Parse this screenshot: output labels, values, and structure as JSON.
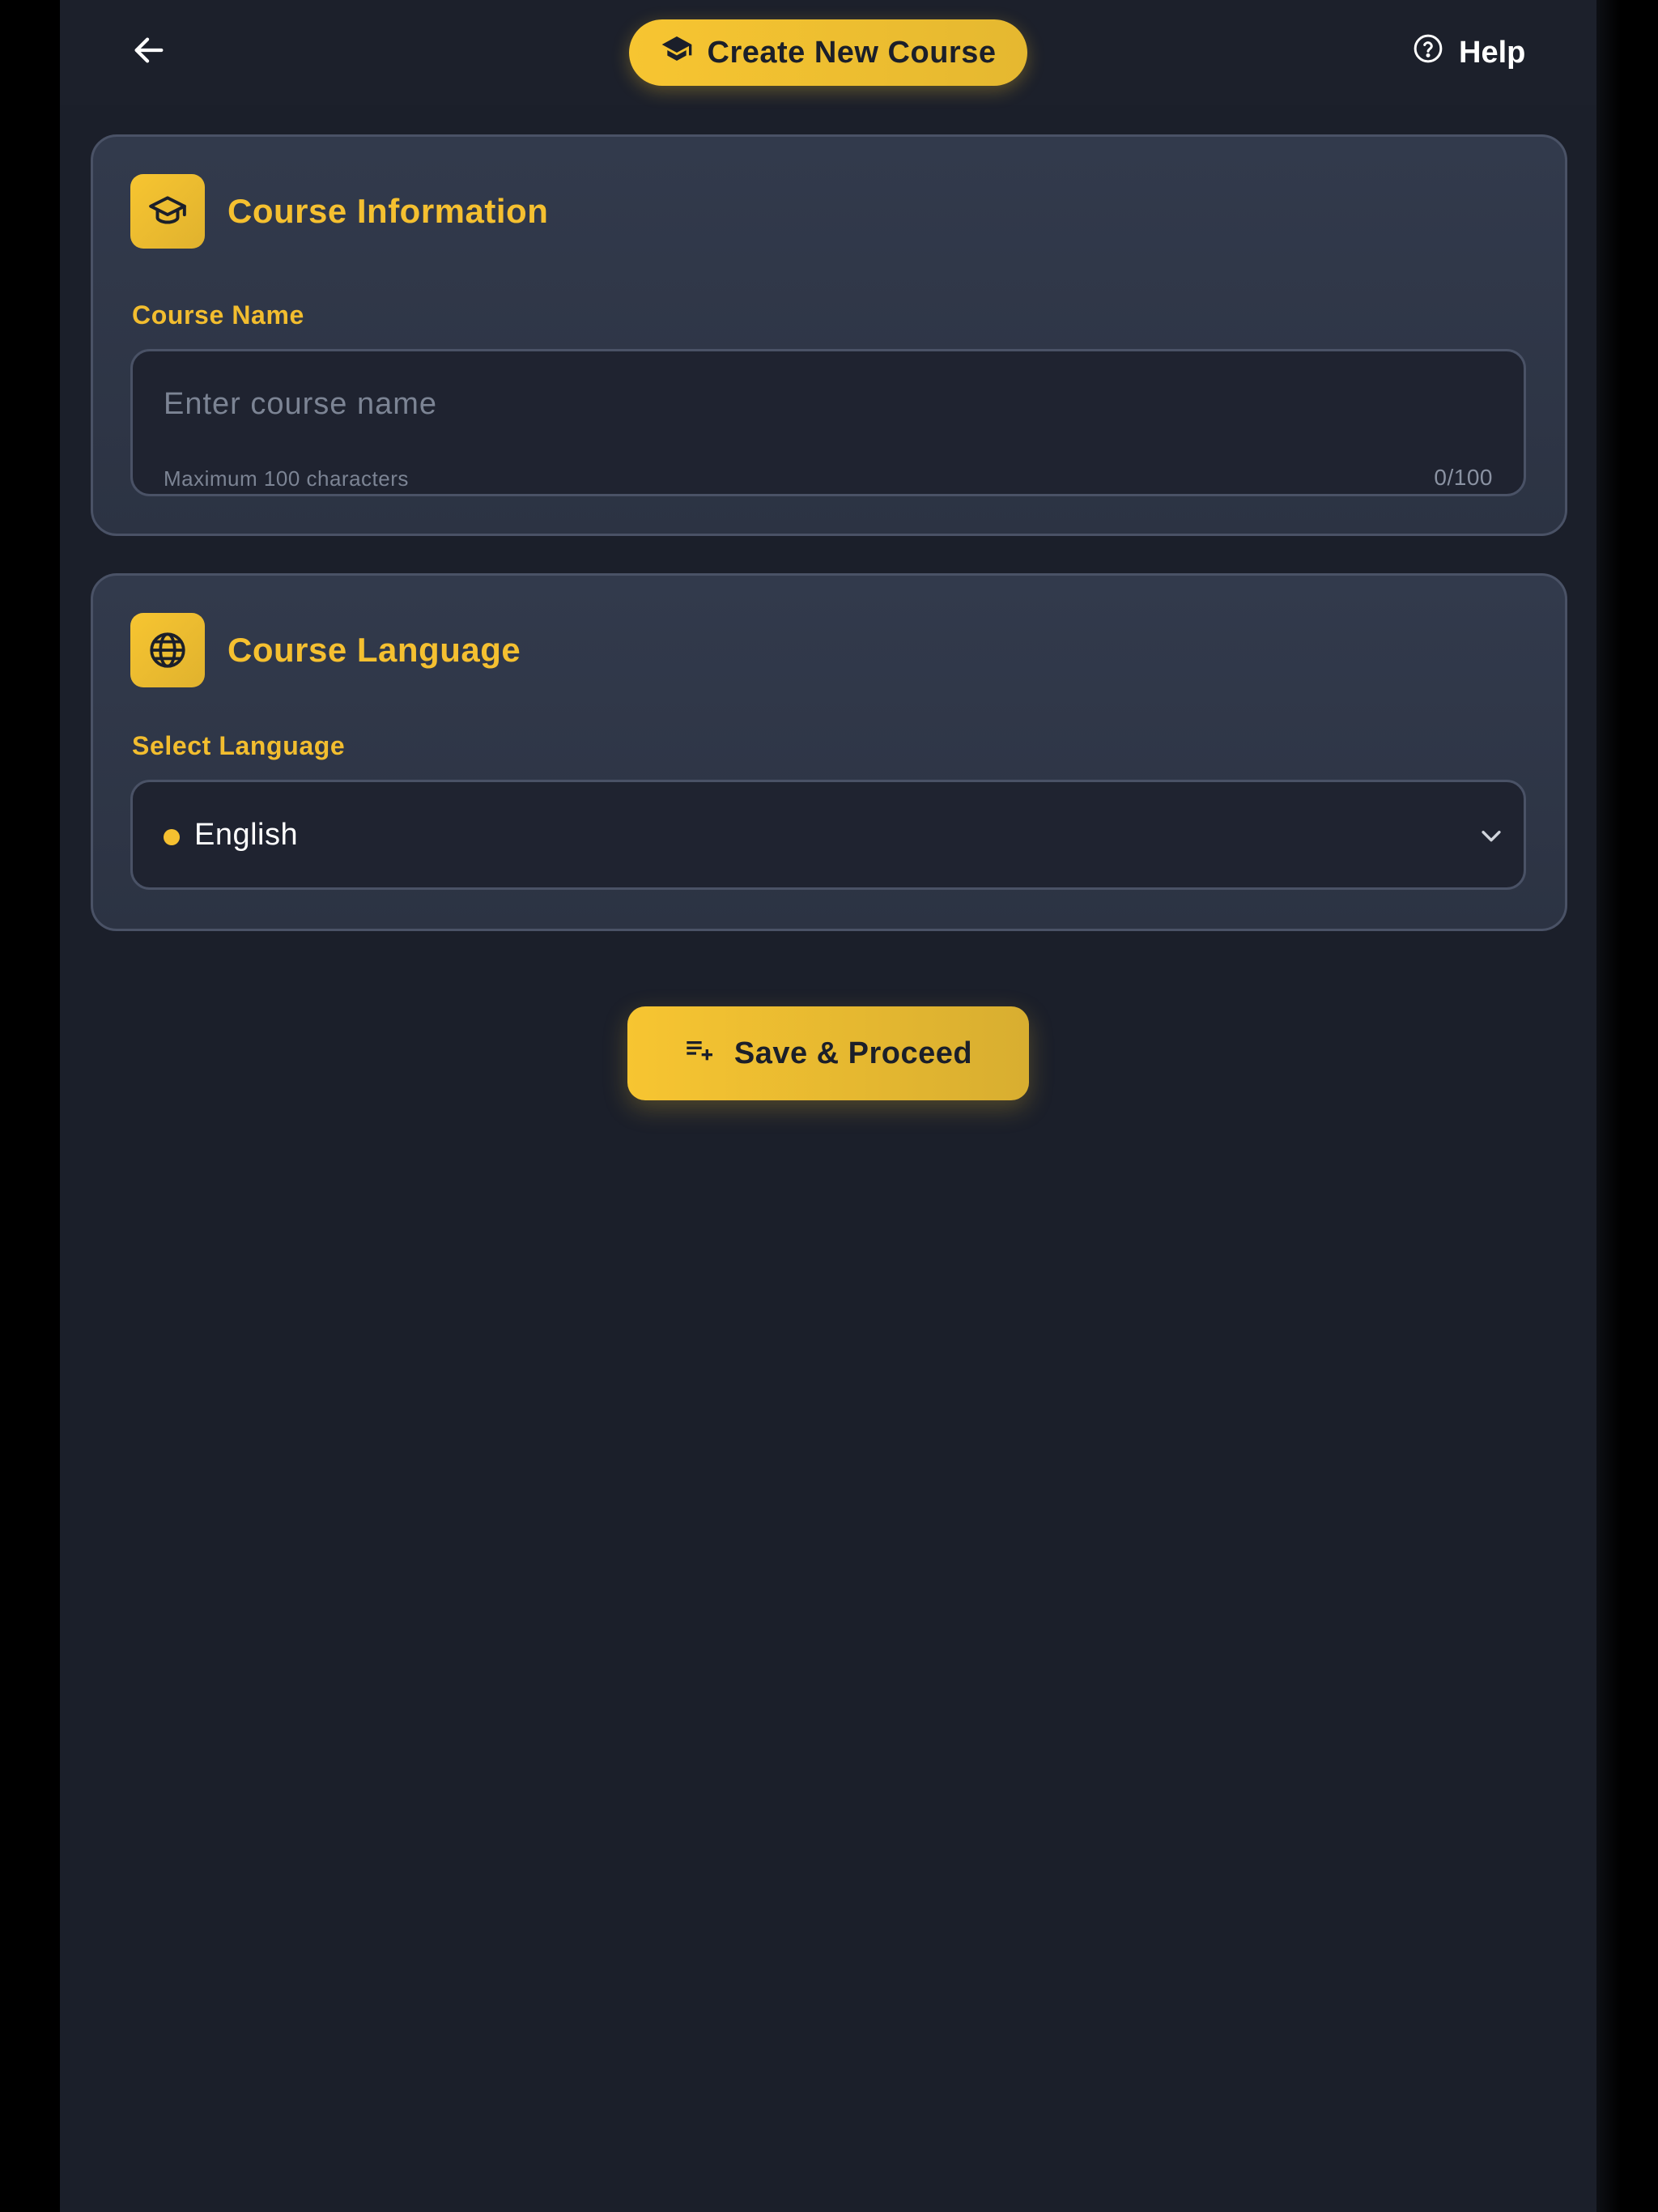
{
  "header": {
    "back_icon": "arrow-left-icon",
    "title": "Create New Course",
    "title_icon": "graduation-cap-icon",
    "help_label": "Help",
    "help_icon": "question-circle-icon"
  },
  "course_information": {
    "title": "Course Information",
    "icon": "graduation-cap-icon",
    "course_name": {
      "label": "Course Name",
      "value": "",
      "placeholder": "Enter course name",
      "hint": "Maximum 100 characters",
      "counter": "0/100"
    }
  },
  "course_language": {
    "title": "Course Language",
    "icon": "globe-icon",
    "select": {
      "label": "Select Language",
      "value": "English"
    }
  },
  "actions": {
    "save_label": "Save & Proceed",
    "save_icon": "playlist-add-icon"
  },
  "colors": {
    "accent": "#f5c030",
    "background": "#1b1f2a",
    "card": "#2f3647",
    "input": "#1f2330"
  }
}
